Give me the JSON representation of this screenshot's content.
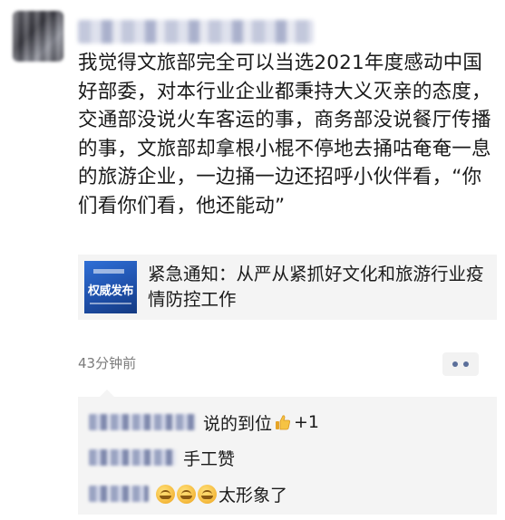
{
  "post": {
    "text": "我觉得文旅部完全可以当选2021年度感动中国好部委，对本行业企业都秉持大义灭亲的态度，交通部没说火车客运的事，商务部没说餐厅传播的事，文旅部却拿根小棍不停地去捅咕奄奄一息的旅游企业，一边捅一边还招呼小伙伴看，“你们看你们看，他还能动”",
    "timestamp": "43分钟前"
  },
  "link_card": {
    "thumb_text": "权威发布",
    "title": "紧急通知：从严从紧抓好文化和旅游行业疫情防控工作"
  },
  "comments": [
    {
      "text": "说的到位",
      "suffix": "+1",
      "icon": "thumbs-up-icon"
    },
    {
      "text": "手工赞"
    },
    {
      "text": "太形象了",
      "icon": "laughing-emoji-icon"
    }
  ],
  "colors": {
    "link_card_bg": "#f4f4f4",
    "timestamp": "#7b7b7b",
    "more_dots": "#5b6f9a"
  }
}
